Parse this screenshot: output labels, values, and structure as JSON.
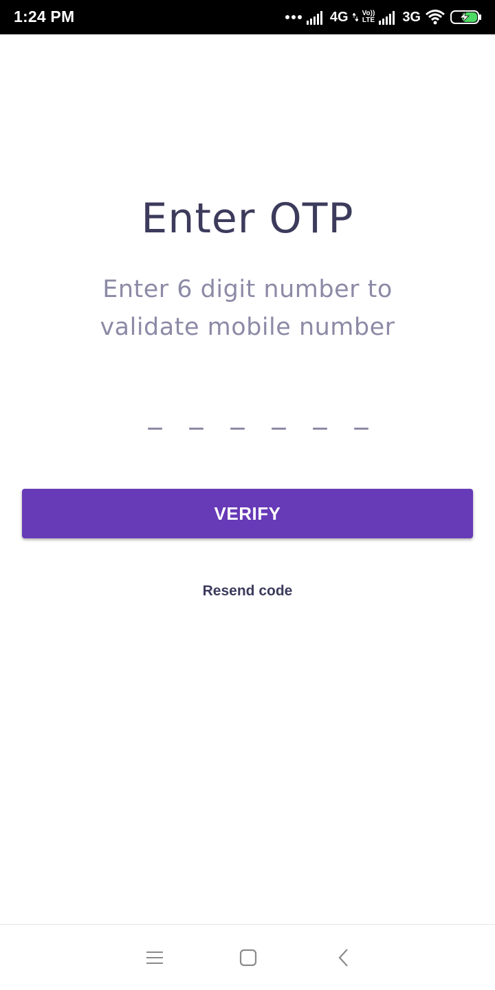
{
  "status_bar": {
    "time": "1:24 PM",
    "network_1": "4G",
    "volte_top": "Vo))",
    "volte_bottom": "LTE",
    "network_2": "3G",
    "icons": [
      "more-dots-icon",
      "signal-icon",
      "signal-icon",
      "wifi-icon",
      "battery-charging-icon"
    ]
  },
  "main": {
    "title": "Enter OTP",
    "subtitle": "Enter 6 digit number to validate mobile number",
    "otp_length": 6,
    "verify_label": "VERIFY",
    "resend_label": "Resend code"
  },
  "nav_bar": {
    "icons": [
      "menu-icon",
      "home-icon",
      "back-icon"
    ]
  },
  "colors": {
    "accent": "#673ab7",
    "title": "#3c3b5c",
    "subtitle": "#8c8aa6",
    "status_bar": "#000000",
    "battery_fill": "#4cd964"
  }
}
